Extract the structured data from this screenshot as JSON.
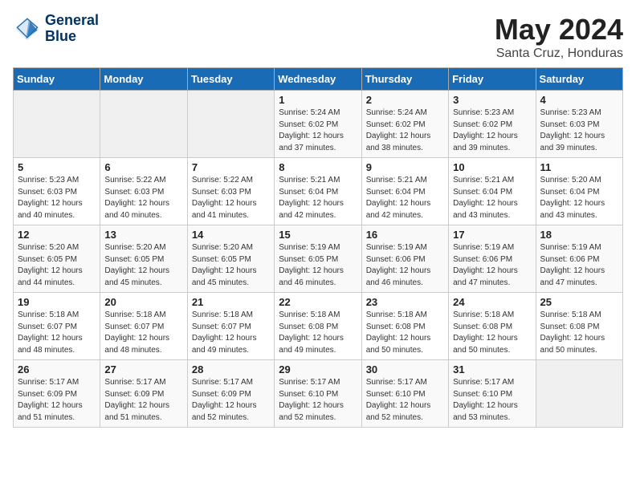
{
  "header": {
    "logo_line1": "General",
    "logo_line2": "Blue",
    "month": "May 2024",
    "location": "Santa Cruz, Honduras"
  },
  "weekdays": [
    "Sunday",
    "Monday",
    "Tuesday",
    "Wednesday",
    "Thursday",
    "Friday",
    "Saturday"
  ],
  "weeks": [
    [
      {
        "day": "",
        "info": ""
      },
      {
        "day": "",
        "info": ""
      },
      {
        "day": "",
        "info": ""
      },
      {
        "day": "1",
        "info": "Sunrise: 5:24 AM\nSunset: 6:02 PM\nDaylight: 12 hours\nand 37 minutes."
      },
      {
        "day": "2",
        "info": "Sunrise: 5:24 AM\nSunset: 6:02 PM\nDaylight: 12 hours\nand 38 minutes."
      },
      {
        "day": "3",
        "info": "Sunrise: 5:23 AM\nSunset: 6:02 PM\nDaylight: 12 hours\nand 39 minutes."
      },
      {
        "day": "4",
        "info": "Sunrise: 5:23 AM\nSunset: 6:03 PM\nDaylight: 12 hours\nand 39 minutes."
      }
    ],
    [
      {
        "day": "5",
        "info": "Sunrise: 5:23 AM\nSunset: 6:03 PM\nDaylight: 12 hours\nand 40 minutes."
      },
      {
        "day": "6",
        "info": "Sunrise: 5:22 AM\nSunset: 6:03 PM\nDaylight: 12 hours\nand 40 minutes."
      },
      {
        "day": "7",
        "info": "Sunrise: 5:22 AM\nSunset: 6:03 PM\nDaylight: 12 hours\nand 41 minutes."
      },
      {
        "day": "8",
        "info": "Sunrise: 5:21 AM\nSunset: 6:04 PM\nDaylight: 12 hours\nand 42 minutes."
      },
      {
        "day": "9",
        "info": "Sunrise: 5:21 AM\nSunset: 6:04 PM\nDaylight: 12 hours\nand 42 minutes."
      },
      {
        "day": "10",
        "info": "Sunrise: 5:21 AM\nSunset: 6:04 PM\nDaylight: 12 hours\nand 43 minutes."
      },
      {
        "day": "11",
        "info": "Sunrise: 5:20 AM\nSunset: 6:04 PM\nDaylight: 12 hours\nand 43 minutes."
      }
    ],
    [
      {
        "day": "12",
        "info": "Sunrise: 5:20 AM\nSunset: 6:05 PM\nDaylight: 12 hours\nand 44 minutes."
      },
      {
        "day": "13",
        "info": "Sunrise: 5:20 AM\nSunset: 6:05 PM\nDaylight: 12 hours\nand 45 minutes."
      },
      {
        "day": "14",
        "info": "Sunrise: 5:20 AM\nSunset: 6:05 PM\nDaylight: 12 hours\nand 45 minutes."
      },
      {
        "day": "15",
        "info": "Sunrise: 5:19 AM\nSunset: 6:05 PM\nDaylight: 12 hours\nand 46 minutes."
      },
      {
        "day": "16",
        "info": "Sunrise: 5:19 AM\nSunset: 6:06 PM\nDaylight: 12 hours\nand 46 minutes."
      },
      {
        "day": "17",
        "info": "Sunrise: 5:19 AM\nSunset: 6:06 PM\nDaylight: 12 hours\nand 47 minutes."
      },
      {
        "day": "18",
        "info": "Sunrise: 5:19 AM\nSunset: 6:06 PM\nDaylight: 12 hours\nand 47 minutes."
      }
    ],
    [
      {
        "day": "19",
        "info": "Sunrise: 5:18 AM\nSunset: 6:07 PM\nDaylight: 12 hours\nand 48 minutes."
      },
      {
        "day": "20",
        "info": "Sunrise: 5:18 AM\nSunset: 6:07 PM\nDaylight: 12 hours\nand 48 minutes."
      },
      {
        "day": "21",
        "info": "Sunrise: 5:18 AM\nSunset: 6:07 PM\nDaylight: 12 hours\nand 49 minutes."
      },
      {
        "day": "22",
        "info": "Sunrise: 5:18 AM\nSunset: 6:08 PM\nDaylight: 12 hours\nand 49 minutes."
      },
      {
        "day": "23",
        "info": "Sunrise: 5:18 AM\nSunset: 6:08 PM\nDaylight: 12 hours\nand 50 minutes."
      },
      {
        "day": "24",
        "info": "Sunrise: 5:18 AM\nSunset: 6:08 PM\nDaylight: 12 hours\nand 50 minutes."
      },
      {
        "day": "25",
        "info": "Sunrise: 5:18 AM\nSunset: 6:08 PM\nDaylight: 12 hours\nand 50 minutes."
      }
    ],
    [
      {
        "day": "26",
        "info": "Sunrise: 5:17 AM\nSunset: 6:09 PM\nDaylight: 12 hours\nand 51 minutes."
      },
      {
        "day": "27",
        "info": "Sunrise: 5:17 AM\nSunset: 6:09 PM\nDaylight: 12 hours\nand 51 minutes."
      },
      {
        "day": "28",
        "info": "Sunrise: 5:17 AM\nSunset: 6:09 PM\nDaylight: 12 hours\nand 52 minutes."
      },
      {
        "day": "29",
        "info": "Sunrise: 5:17 AM\nSunset: 6:10 PM\nDaylight: 12 hours\nand 52 minutes."
      },
      {
        "day": "30",
        "info": "Sunrise: 5:17 AM\nSunset: 6:10 PM\nDaylight: 12 hours\nand 52 minutes."
      },
      {
        "day": "31",
        "info": "Sunrise: 5:17 AM\nSunset: 6:10 PM\nDaylight: 12 hours\nand 53 minutes."
      },
      {
        "day": "",
        "info": ""
      }
    ]
  ]
}
